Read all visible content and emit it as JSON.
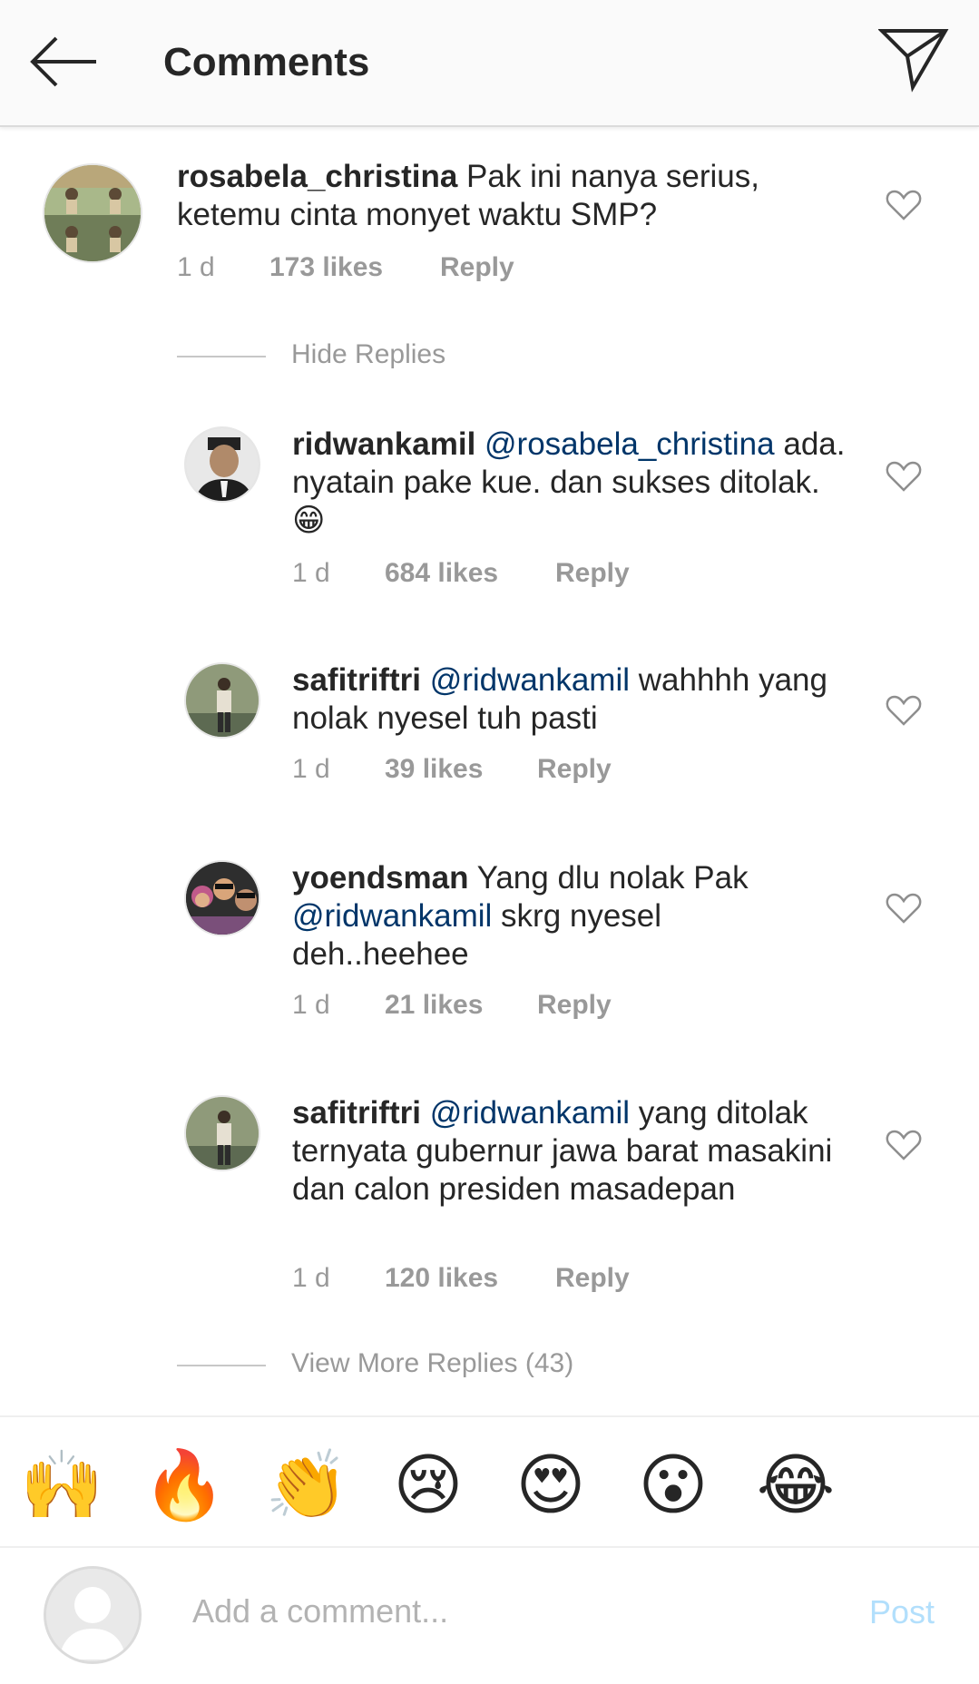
{
  "header": {
    "title": "Comments",
    "back_icon": "arrow-left-icon",
    "share_icon": "paper-plane-icon"
  },
  "main_comment": {
    "username": "rosabela_christina",
    "text": " Pak ini nanya serius, ketemu cinta monyet waktu SMP?",
    "time": "1 d",
    "likes": "173 likes",
    "reply": "Reply"
  },
  "hide_replies": "Hide Replies",
  "replies": [
    {
      "username": "ridwankamil",
      "mention": "@rosabela_christina",
      "text": " ada. nyatain pake kue. dan sukses ditolak.",
      "emoji": "😁",
      "time": "1 d",
      "likes": "684 likes",
      "reply": "Reply"
    },
    {
      "username": "safitriftri",
      "mention": "@ridwankamil",
      "text": " wahhhh yang nolak nyesel tuh pasti",
      "time": "1 d",
      "likes": "39 likes",
      "reply": "Reply"
    },
    {
      "username": "yoendsman",
      "pre": " Yang dlu nolak Pak",
      "mention": "@ridwankamil",
      "text": " skrg nyesel deh..heehee",
      "time": "1 d",
      "likes": "21 likes",
      "reply": "Reply"
    },
    {
      "username": "safitriftri",
      "mention": "@ridwankamil",
      "text": " yang ditolak ternyata gubernur jawa barat masakini dan calon presiden masadepan",
      "time": "1 d",
      "likes": "120 likes",
      "reply": "Reply"
    }
  ],
  "view_more": "View More Replies (43)",
  "emoji_bar": [
    "🙌",
    "🔥",
    "👏",
    "😢",
    "😍",
    "😮",
    "😂"
  ],
  "composer": {
    "placeholder": "Add a comment...",
    "post_label": "Post"
  },
  "colors": {
    "mention": "#003569",
    "meta": "#999999",
    "post_disabled": "#b2dffc"
  }
}
